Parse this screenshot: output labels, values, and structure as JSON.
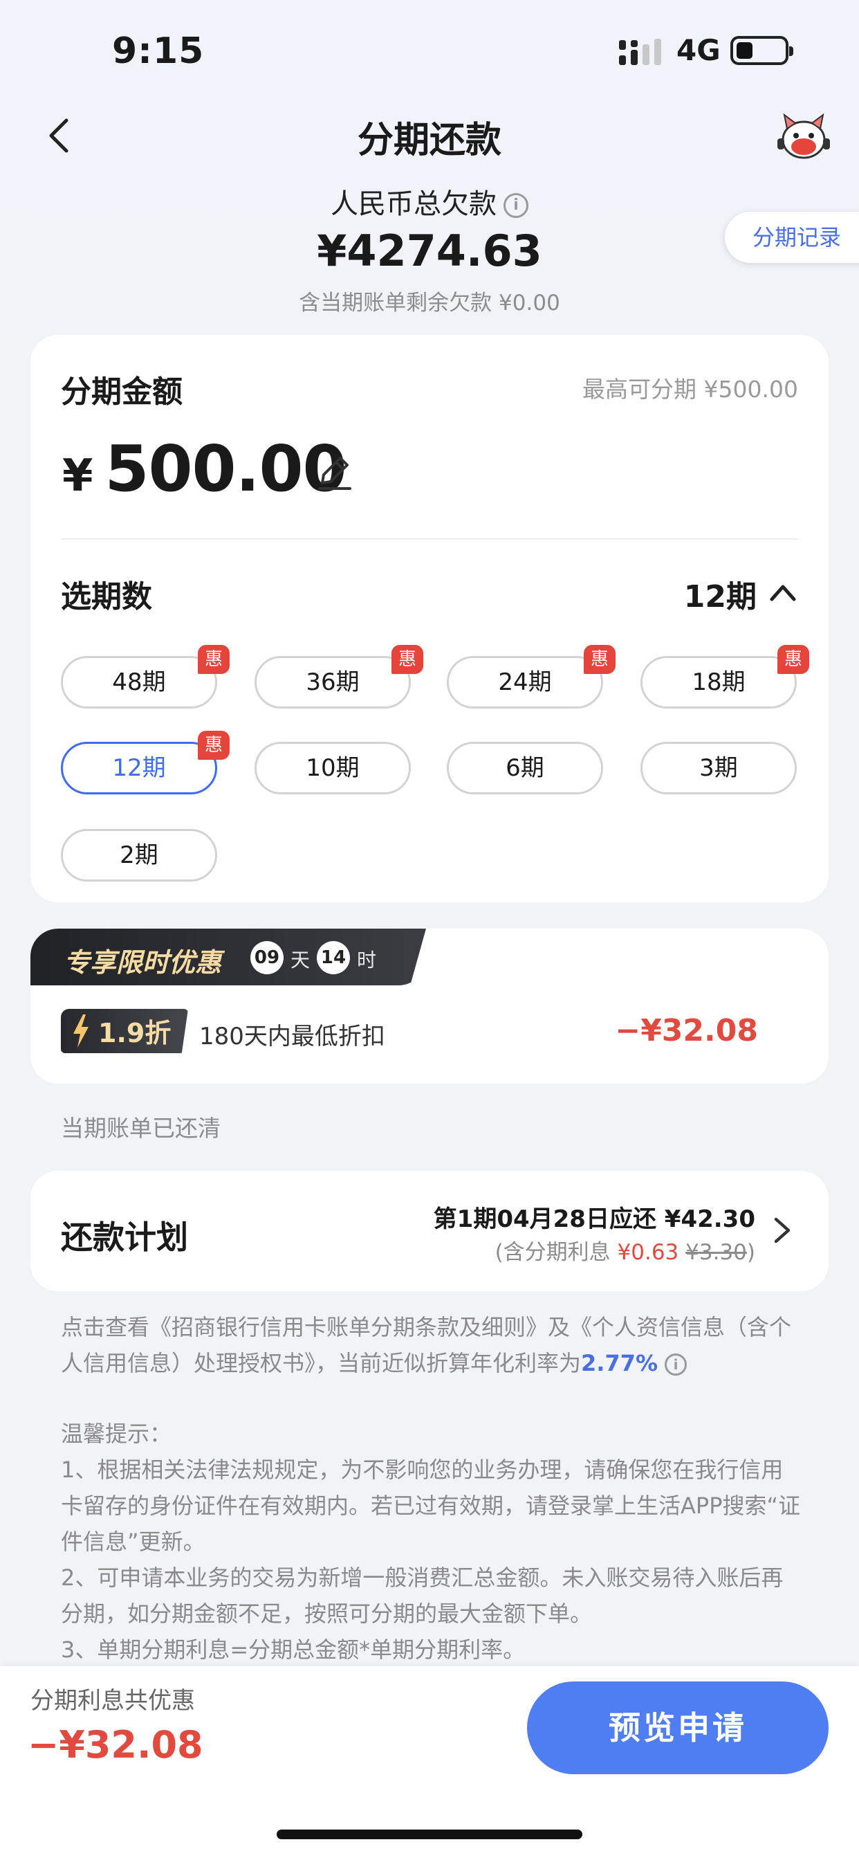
{
  "status_bar": {
    "time": "9:15",
    "network": "4G",
    "battery_level": 0.35
  },
  "nav": {
    "title": "分期还款",
    "records_label": "分期记录"
  },
  "summary": {
    "total_label": "人民币总欠款",
    "total_amount": "¥4274.63",
    "sub_note": "含当期账单剩余欠款 ¥0.00"
  },
  "amount_card": {
    "label": "分期金额",
    "max_note": "最高可分期 ¥500.00",
    "currency": "¥",
    "value": "500.00"
  },
  "terms_selector": {
    "label": "选期数",
    "selected": "12期",
    "options": [
      {
        "label": "48期",
        "tag": "惠"
      },
      {
        "label": "36期",
        "tag": "惠"
      },
      {
        "label": "24期",
        "tag": "惠"
      },
      {
        "label": "18期",
        "tag": "惠"
      },
      {
        "label": "12期",
        "tag": "惠"
      },
      {
        "label": "10期"
      },
      {
        "label": "6期"
      },
      {
        "label": "3期"
      },
      {
        "label": "2期"
      }
    ]
  },
  "promo": {
    "title": "专享限时优惠",
    "days": "09",
    "days_unit": "天",
    "hours": "14",
    "hours_unit": "时",
    "discount_badge": "1.9折",
    "discount_desc": "180天内最低折扣",
    "discount_amount": "−¥32.08"
  },
  "paid_note": "当期账单已还清",
  "plan": {
    "label": "还款计划",
    "line1": "第1期04月28日应还 ¥42.30",
    "line2_prefix": "(含分期利息 ",
    "interest_now": "¥0.63",
    "interest_orig": "¥3.30",
    "line2_suffix": ")"
  },
  "terms_text": {
    "main": "点击查看《招商银行信用卡账单分期条款及细则》及《个人资信信息（含个人信用信息）处理授权书》，当前近似折算年化利率为",
    "rate": "2.77%"
  },
  "tips": {
    "title": "温馨提示：",
    "items": [
      "1、根据相关法律法规规定，为不影响您的业务办理，请确保您在我行信用卡留存的身份证件在有效期内。若已过有效期，请登录掌上生活APP搜索“证件信息”更新。",
      "2、可申请本业务的交易为新增一般消费汇总金额。未入账交易待入账后再分期，如分期金额不足，按照可分期的最大金额下单。",
      "3、单期分期利息=分期总金额*单期分期利率。"
    ]
  },
  "bottom": {
    "label": "分期利息共优惠",
    "amount": "−¥32.08",
    "button": "预览申请"
  },
  "colors": {
    "accent": "#3d6cf0",
    "button": "#4e7ef2",
    "discount": "#e04a3f",
    "tag": "#e5443b"
  }
}
